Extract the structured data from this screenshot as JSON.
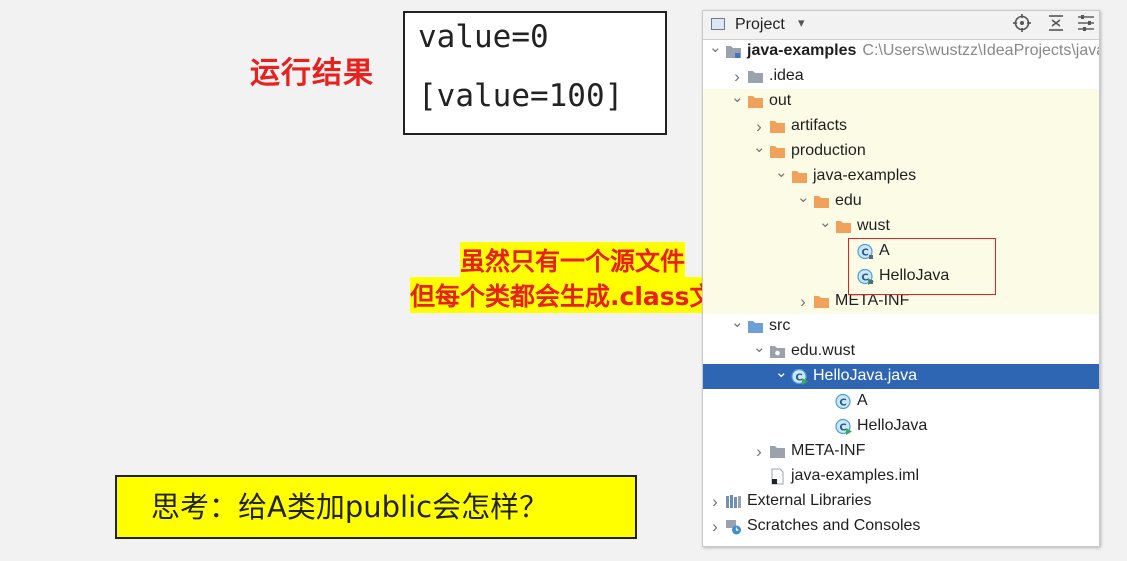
{
  "annotations": {
    "run_label": "运行结果",
    "console_line1": "value=0",
    "console_line2": "[value=100]",
    "note_line1": "虽然只有一个源文件",
    "note_line2": "但每个类都会生成.class文件",
    "question": "思考：给A类加public会怎样？"
  },
  "panel": {
    "title": "Project",
    "dropdown": "▾",
    "toolbar_icons": [
      "locate-icon",
      "collapse-all-icon",
      "settings-icon"
    ]
  },
  "tree": [
    {
      "label": "java-examples",
      "bold": true,
      "path": "C:\\Users\\wustzz\\IdeaProjects\\java",
      "icon": "module-icon",
      "indent": 0,
      "chevron": "down"
    },
    {
      "label": ".idea",
      "icon": "folder-gray-icon",
      "indent": 1,
      "chevron": "right"
    },
    {
      "label": "out",
      "icon": "folder-orange-icon",
      "indent": 1,
      "chevron": "down",
      "hl": true
    },
    {
      "label": "artifacts",
      "icon": "folder-orange-icon",
      "indent": 2,
      "chevron": "right",
      "hl": true
    },
    {
      "label": "production",
      "icon": "folder-orange-icon",
      "indent": 2,
      "chevron": "down",
      "hl": true
    },
    {
      "label": "java-examples",
      "icon": "folder-orange-icon",
      "indent": 3,
      "chevron": "down",
      "hl": true
    },
    {
      "label": "edu",
      "icon": "folder-orange-icon",
      "indent": 4,
      "chevron": "down",
      "hl": true
    },
    {
      "label": "wust",
      "icon": "folder-orange-icon",
      "indent": 5,
      "chevron": "down",
      "hl": true
    },
    {
      "label": "A",
      "icon": "class-file-icon",
      "indent": 6,
      "chevron": "",
      "hl": true
    },
    {
      "label": "HelloJava",
      "icon": "class-run-file-icon",
      "indent": 6,
      "chevron": "",
      "hl": true
    },
    {
      "label": "META-INF",
      "icon": "folder-orange-icon",
      "indent": 4,
      "chevron": "right",
      "hl": true
    },
    {
      "label": "src",
      "icon": "folder-blue-icon",
      "indent": 1,
      "chevron": "down"
    },
    {
      "label": "edu.wust",
      "icon": "package-icon",
      "indent": 2,
      "chevron": "down"
    },
    {
      "label": "HelloJava.java",
      "icon": "java-run-class-icon",
      "indent": 3,
      "chevron": "down",
      "sel": true
    },
    {
      "label": "A",
      "icon": "class-icon",
      "indent": 5,
      "chevron": ""
    },
    {
      "label": "HelloJava",
      "icon": "class-run-icon",
      "indent": 5,
      "chevron": ""
    },
    {
      "label": "META-INF",
      "icon": "folder-gray-icon",
      "indent": 2,
      "chevron": "right"
    },
    {
      "label": "java-examples.iml",
      "icon": "iml-file-icon",
      "indent": 2,
      "chevron": ""
    },
    {
      "label": "External Libraries",
      "icon": "libraries-icon",
      "indent": 0,
      "chevron": "right"
    },
    {
      "label": "Scratches and Consoles",
      "icon": "scratches-icon",
      "indent": 0,
      "chevron": "right"
    }
  ],
  "colors": {
    "accent_red": "#e8201e",
    "highlight_yellow": "#ffff00",
    "selection_blue": "#2f66b3",
    "folder_orange": "#f0a15c",
    "folder_gray": "#9aa3ad",
    "folder_blue": "#6f9fd8",
    "class_icon_fill": "#cfe6f6"
  }
}
